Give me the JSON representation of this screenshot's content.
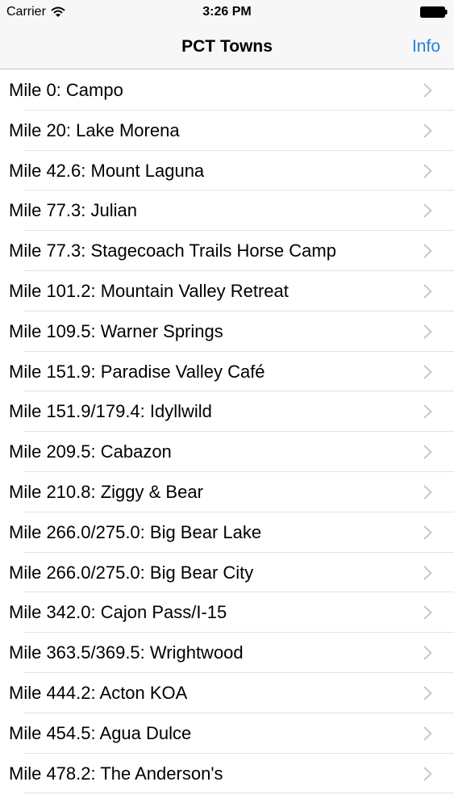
{
  "status_bar": {
    "carrier": "Carrier",
    "time": "3:26 PM"
  },
  "nav": {
    "title": "PCT Towns",
    "info_label": "Info",
    "accent_color": "#1f7fd8"
  },
  "towns": [
    "Mile 0: Campo",
    "Mile 20: Lake Morena",
    "Mile 42.6: Mount Laguna",
    "Mile 77.3: Julian",
    "Mile 77.3: Stagecoach Trails Horse Camp",
    "Mile 101.2: Mountain Valley Retreat",
    "Mile 109.5: Warner Springs",
    "Mile 151.9: Paradise Valley Café",
    "Mile 151.9/179.4: Idyllwild",
    "Mile 209.5: Cabazon",
    "Mile 210.8: Ziggy & Bear",
    "Mile 266.0/275.0: Big Bear Lake",
    "Mile 266.0/275.0: Big Bear City",
    "Mile 342.0: Cajon Pass/I-15",
    "Mile 363.5/369.5: Wrightwood",
    "Mile 444.2: Acton KOA",
    "Mile 454.5: Agua Dulce",
    "Mile 478.2: The Anderson's"
  ]
}
